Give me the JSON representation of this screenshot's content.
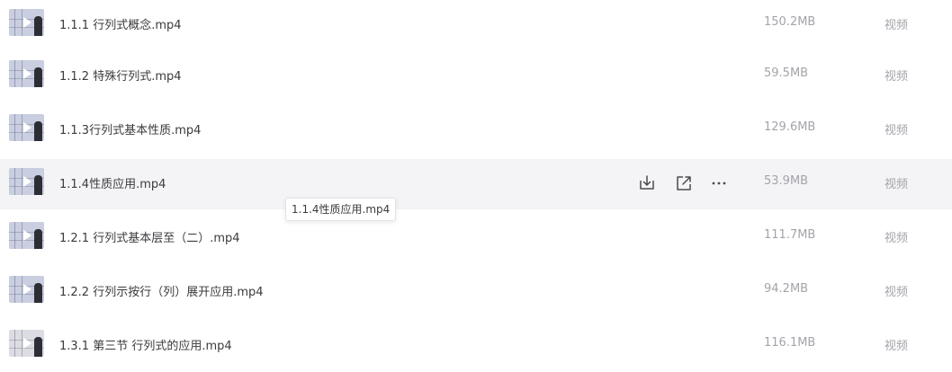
{
  "files": [
    {
      "name": "1.1.1 行列式概念.mp4",
      "size": "150.2MB",
      "type": "视频",
      "thumb": "play-thumbnail",
      "hovered": false
    },
    {
      "name": "1.1.2 特殊行列式.mp4",
      "size": "59.5MB",
      "type": "视频",
      "thumb": "play-thumbnail",
      "hovered": false
    },
    {
      "name": "1.1.3行列式基本性质.mp4",
      "size": "129.6MB",
      "type": "视频",
      "thumb": "play-thumbnail",
      "hovered": false
    },
    {
      "name": "1.1.4性质应用.mp4",
      "size": "53.9MB",
      "type": "视频",
      "thumb": "play-thumbnail",
      "hovered": true
    },
    {
      "name": "1.2.1 行列式基本层至（二）.mp4",
      "size": "111.7MB",
      "type": "视频",
      "thumb": "play-thumbnail",
      "hovered": false
    },
    {
      "name": "1.2.2 行列示按行（列）展开应用.mp4",
      "size": "94.2MB",
      "type": "视频",
      "thumb": "play-thumbnail",
      "hovered": false
    },
    {
      "name": "1.3.1 第三节 行列式的应用.mp4",
      "size": "116.1MB",
      "type": "视频",
      "thumb": "play-thumbnail",
      "hovered": false
    }
  ],
  "row_actions": [
    {
      "name": "download-button",
      "icon": "download-icon"
    },
    {
      "name": "share-button",
      "icon": "share-icon"
    },
    {
      "name": "more-button",
      "icon": "more-icon"
    }
  ],
  "tooltip": {
    "text": "1.1.4性质应用.mp4"
  },
  "colors": {
    "hover_row": "#f4f4f6",
    "name_text": "#3b3b3f",
    "meta_text": "#a3a4aa"
  }
}
